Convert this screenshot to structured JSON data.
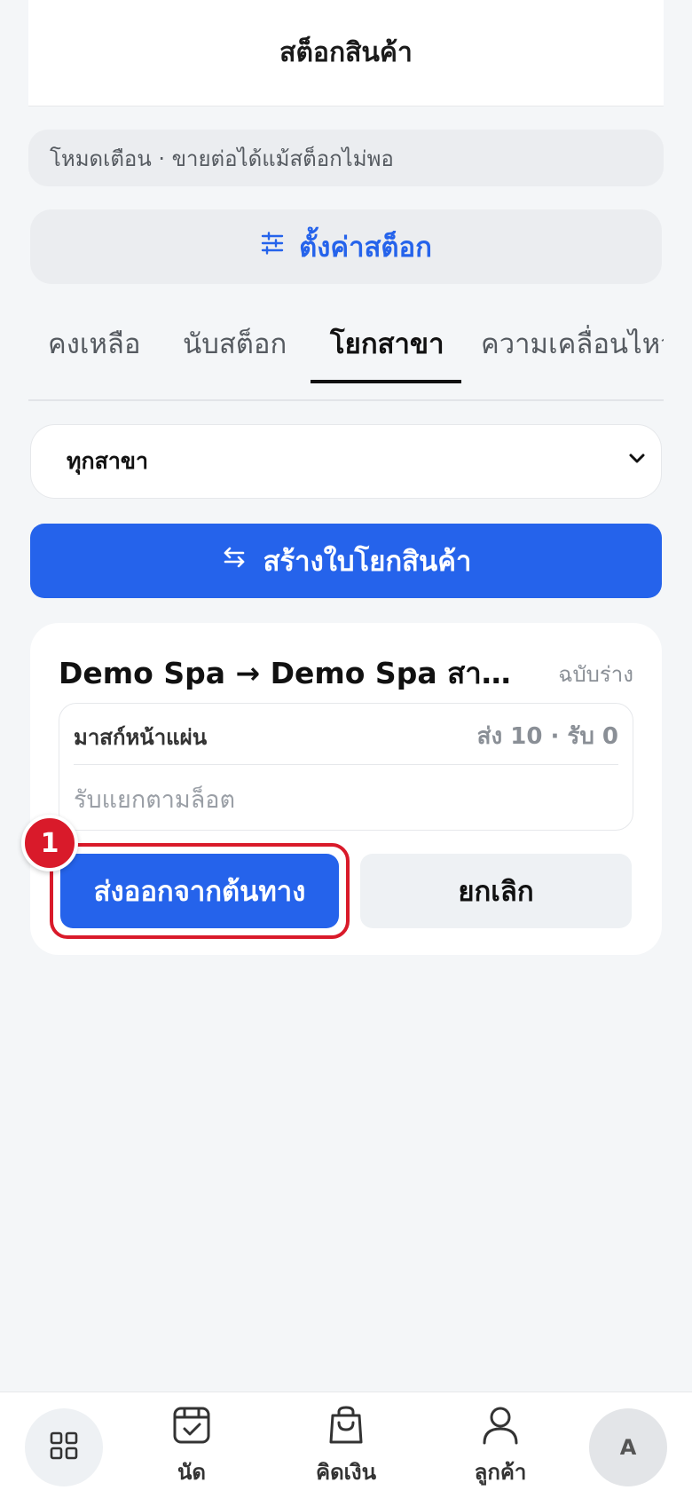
{
  "header": {
    "title": "สต็อกสินค้า"
  },
  "notice": {
    "text": "โหมดเตือน · ขายต่อได้แม้สต็อกไม่พอ"
  },
  "settings_button": {
    "label": "ตั้งค่าสต็อก",
    "icon": "sliders-icon"
  },
  "tabs": [
    {
      "label": "คงเหลือ",
      "active": false
    },
    {
      "label": "นับสต็อก",
      "active": false
    },
    {
      "label": "โยกสาขา",
      "active": true
    },
    {
      "label": "ความเคลื่อนไหว",
      "active": false
    }
  ],
  "branch_select": {
    "value": "ทุกสาขา"
  },
  "create_button": {
    "label": "สร้างใบโยกสินค้า",
    "icon": "swap-arrows-icon"
  },
  "transfer_card": {
    "title": "Demo Spa → Demo Spa สาขาล...",
    "status": "ฉบับร่าง",
    "item": {
      "name": "มาสก์หน้าแผ่น",
      "qty": "ส่ง 10 · รับ 0",
      "note": "รับแยกตามล็อต"
    },
    "ship_button": "ส่งออกจากต้นทาง",
    "cancel_button": "ยกเลิก"
  },
  "step_badge": "1",
  "bottom_nav": {
    "items": [
      {
        "label": "",
        "icon": "grid-icon"
      },
      {
        "label": "นัด",
        "icon": "calendar-check-icon"
      },
      {
        "label": "คิดเงิน",
        "icon": "shopping-bag-icon"
      },
      {
        "label": "ลูกค้า",
        "icon": "user-icon"
      }
    ],
    "avatar": "A"
  },
  "colors": {
    "accent": "#2563eb",
    "highlight": "#d91a2a",
    "background": "#f4f6f8"
  }
}
